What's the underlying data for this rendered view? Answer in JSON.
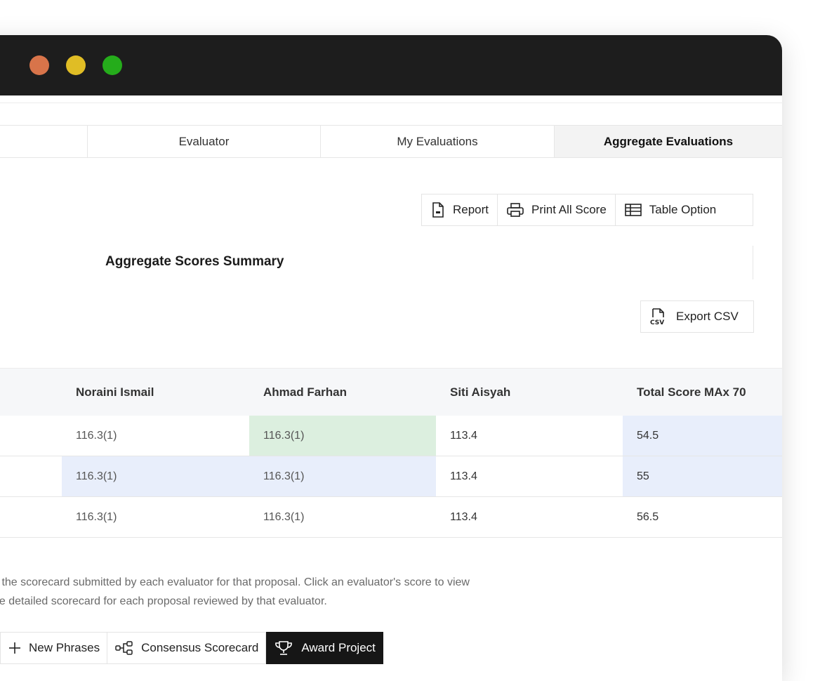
{
  "tabs": [
    {
      "label": "Evaluator"
    },
    {
      "label": "My Evaluations"
    },
    {
      "label": "Aggregate Evaluations",
      "active": true
    }
  ],
  "toolbar": {
    "report_label": "Report",
    "print_label": "Print All Score",
    "table_option_label": "Table Option"
  },
  "section": {
    "title": "Aggregate Scores Summary",
    "export_label": "Export CSV"
  },
  "table": {
    "headers": [
      "Noraini Ismail",
      "Ahmad Farhan",
      "Siti Aisyah",
      "Total Score MAx 70"
    ],
    "rows": [
      [
        "116.3(1)",
        "116.3(1)",
        "113.4",
        "54.5"
      ],
      [
        "116.3(1)",
        "116.3(1)",
        "113.4",
        "55"
      ],
      [
        "116.3(1)",
        "116.3(1)",
        "113.4",
        "56.5"
      ]
    ]
  },
  "description": {
    "line1": "v the scorecard submitted by each evaluator for that proposal. Click an evaluator's score to view",
    "line2": "he detailed scorecard for each proposal reviewed by that evaluator."
  },
  "actions": {
    "new_phrases_label": "New Phrases",
    "consensus_label": "Consensus Scorecard",
    "award_label": "Award Project"
  },
  "colors": {
    "titlebar": "#1d1d1d",
    "highlight_green": "#dcefdf",
    "highlight_blue": "#e8eefb",
    "primary_button": "#161616"
  }
}
